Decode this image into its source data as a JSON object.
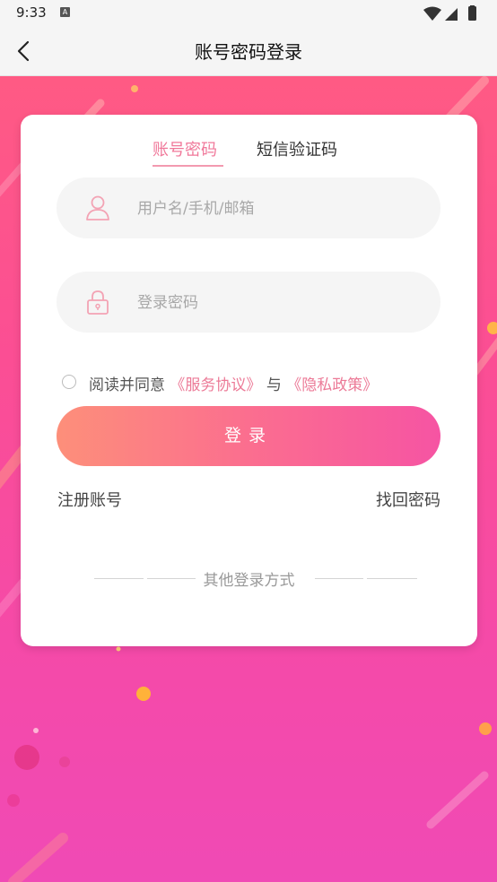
{
  "status_bar": {
    "time": "9:33",
    "notification_icon_letter": "A"
  },
  "header": {
    "title": "账号密码登录",
    "back_icon": "chevron-left-icon"
  },
  "tabs": [
    {
      "label": "账号密码",
      "active": true
    },
    {
      "label": "短信验证码",
      "active": false
    }
  ],
  "form": {
    "username_placeholder": "用户名/手机/邮箱",
    "username_value": "",
    "password_placeholder": "登录密码",
    "password_value": "",
    "agreement_prefix": "阅读并同意",
    "service_agreement": "《服务协议》",
    "agreement_and": "与",
    "privacy_policy": "《隐私政策》",
    "agreement_checked": false,
    "login_button": "登录"
  },
  "links": {
    "register": "注册账号",
    "forgot_password": "找回密码"
  },
  "other_login_label": "其他登录方式",
  "colors": {
    "accent_pink": "#f0789a",
    "button_gradient_start": "#fd8f7a",
    "button_gradient_end": "#f654a3",
    "background_top": "#ff5a84",
    "background_bottom": "#f04ab5"
  }
}
